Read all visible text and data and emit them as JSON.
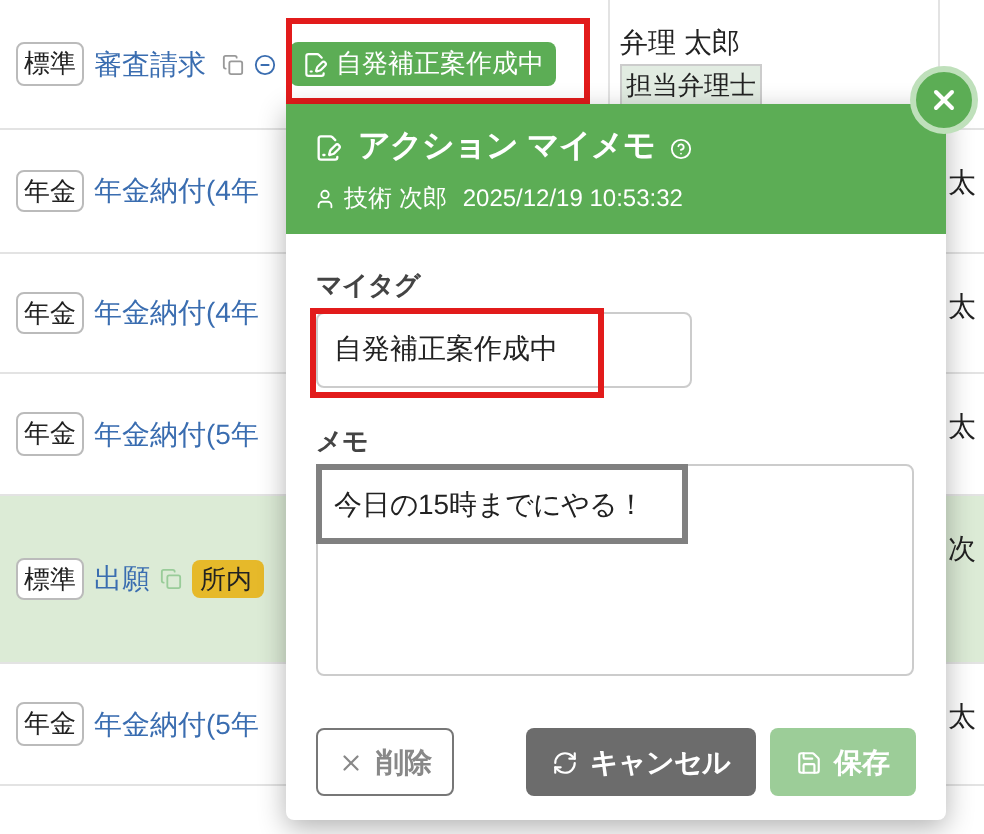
{
  "rows": [
    {
      "tag": "標準",
      "title": "審査請求",
      "icons": true,
      "status": "自発補正案作成中",
      "person": "弁理 太郎",
      "role": "担当弁理士",
      "highlighted": false
    },
    {
      "tag": "年金",
      "title": "年金納付(4年",
      "right": "太",
      "highlighted": false
    },
    {
      "tag": "年金",
      "title": "年金納付(4年",
      "right": "太",
      "highlighted": false
    },
    {
      "tag": "年金",
      "title": "年金納付(5年",
      "right": "太",
      "highlighted": false
    },
    {
      "tag": "標準",
      "title": "出願",
      "copy_icon": true,
      "flag": "所内",
      "right": "次",
      "highlighted": true
    },
    {
      "tag": "年金",
      "title": "年金納付(5年",
      "right": "太",
      "highlighted": false
    }
  ],
  "popover": {
    "title": "アクション マイメモ",
    "author": "技術 次郎",
    "timestamp": "2025/12/19 10:53:32",
    "tag_label": "マイタグ",
    "tag_value": "自発補正案作成中",
    "memo_label": "メモ",
    "memo_value": "今日の15時までにやる！",
    "buttons": [
      {
        "kind": "delete",
        "label": "削除",
        "disabled": false
      },
      {
        "kind": "cancel",
        "label": "キャンセル",
        "disabled": false
      },
      {
        "kind": "save",
        "label": "保存",
        "disabled": true
      }
    ]
  }
}
